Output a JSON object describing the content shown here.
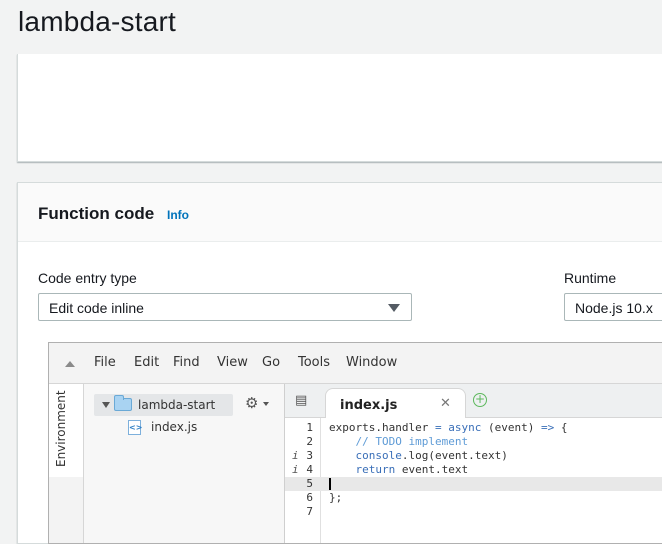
{
  "page": {
    "title": "lambda-start"
  },
  "function_code": {
    "title": "Function code",
    "info_link": "Info",
    "code_entry_type_label": "Code entry type",
    "code_entry_type_value": "Edit code inline",
    "runtime_label": "Runtime",
    "runtime_value": "Node.js 10.x"
  },
  "ide": {
    "menu": [
      "File",
      "Edit",
      "Find",
      "View",
      "Go",
      "Tools",
      "Window"
    ],
    "environment_tab": "Environment",
    "tree": {
      "folder": "lambda-start",
      "file": "index.js"
    },
    "active_tab": "index.js",
    "code_lines": [
      {
        "n": "1",
        "text": "exports.handler = async (event) => {",
        "warn": ""
      },
      {
        "n": "2",
        "text": "    // TODO implement",
        "warn": ""
      },
      {
        "n": "3",
        "text": "    console.log(event.text)",
        "warn": "i"
      },
      {
        "n": "4",
        "text": "    return event.text",
        "warn": "i"
      },
      {
        "n": "5",
        "text": "",
        "warn": ""
      },
      {
        "n": "6",
        "text": "};",
        "warn": ""
      },
      {
        "n": "7",
        "text": "",
        "warn": ""
      }
    ]
  },
  "colors": {
    "link": "#0073bb",
    "keyword": "#3a6fb8",
    "comment": "#5e9bd6",
    "add_tab": "#5db85d"
  }
}
